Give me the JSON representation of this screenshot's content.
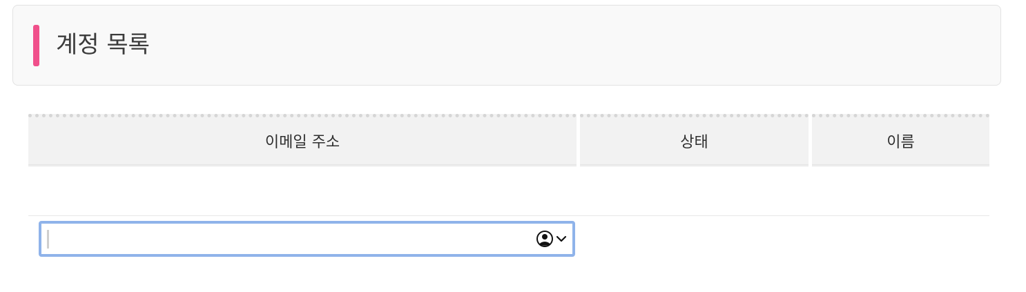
{
  "page": {
    "title": "계정 목록",
    "accent_color": "#f0508b"
  },
  "table": {
    "columns": [
      "이메일 주소",
      "상태",
      "이름"
    ],
    "rows": []
  },
  "email_input": {
    "value": "",
    "placeholder": "",
    "focus_color": "#8fb3ea",
    "icons": [
      "person-circle-icon",
      "chevron-down-icon"
    ]
  }
}
